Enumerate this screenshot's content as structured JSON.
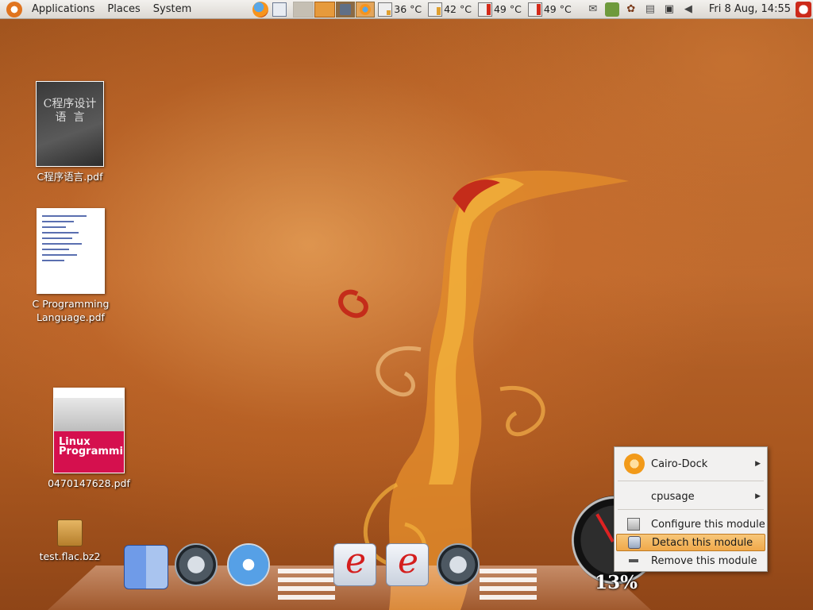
{
  "top_panel": {
    "menus": [
      "Applications",
      "Places",
      "System"
    ],
    "temperatures": [
      "36 °C",
      "42 °C",
      "49 °C",
      "49 °C"
    ],
    "clock": "Fri  8 Aug, 14:55"
  },
  "desktop_icons": {
    "c_book": "C程序语言.pdf",
    "c_book_cover_text": "C程序设计\n语  言",
    "c_prog_line1": "C Programming",
    "c_prog_line2": "Language.pdf",
    "linux_pdf": "0470147628.pdf",
    "linux_cover_text": "Linux\nProgramming",
    "archive": "test.flac.bz2"
  },
  "dock": {
    "icons": [
      "finder-icon",
      "time-machine-icon",
      "safari-icon",
      "evince-icon",
      "evince-icon",
      "time-machine-icon"
    ]
  },
  "cpu_gauge": {
    "value": "13%"
  },
  "context_menu": {
    "items": [
      {
        "label": "Cairo-Dock",
        "submenu": true
      },
      {
        "label": "cpusage",
        "submenu": true
      },
      {
        "label": "Configure this module",
        "submenu": false
      },
      {
        "label": "Detach this module",
        "submenu": false,
        "highlighted": true
      },
      {
        "label": "Remove this module",
        "submenu": false
      }
    ]
  },
  "colors": {
    "panel": "#dcd8d2",
    "menu_highlight": "#f0a94a",
    "wallpaper": "#a9571f"
  }
}
